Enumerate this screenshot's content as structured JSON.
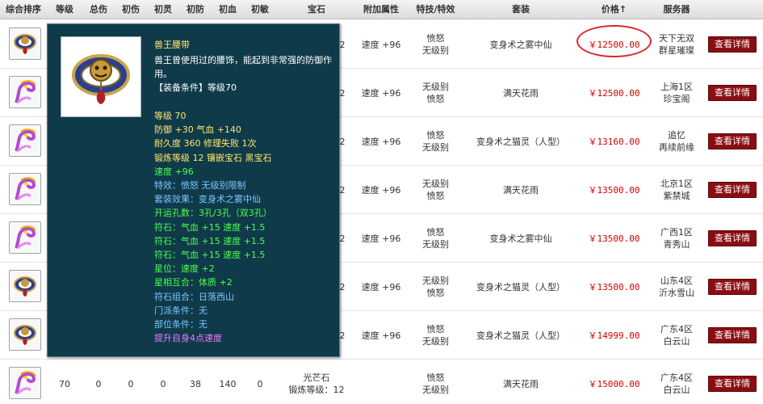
{
  "header": {
    "columns": [
      "综合排序",
      "等级",
      "总伤",
      "初伤",
      "初灵",
      "初防",
      "初血",
      "初敏",
      "宝石",
      "附加属性",
      "特技/特效",
      "套装",
      "价格",
      "服务器"
    ],
    "sort_arrow": "↑"
  },
  "rows": [
    {
      "icon": "belt-icon",
      "attr": "速度 +96",
      "skill1": "愤怒",
      "skill2": "无级别",
      "suit": "变身术之雾中仙",
      "price": "￥12500.00",
      "server1": "天下无双",
      "server2": "群星璀璨",
      "button": "查看详情",
      "gem_tail": "2"
    },
    {
      "icon": "ribbon-icon",
      "attr": "速度 +96",
      "skill1": "无级别",
      "skill2": "愤怒",
      "suit": "满天花雨",
      "price": "￥12500.00",
      "server1": "上海1区",
      "server2": "珍宝阁",
      "button": "查看详情",
      "gem_tail": "2"
    },
    {
      "icon": "ribbon-icon",
      "attr": "速度 +96",
      "skill1": "愤怒",
      "skill2": "无级别",
      "suit": "变身术之猫灵（人型）",
      "price": "￥13160.00",
      "server1": "追忆",
      "server2": "再续前缘",
      "button": "查看详情",
      "gem_tail": "2"
    },
    {
      "icon": "ribbon-icon",
      "attr": "速度 +96",
      "skill1": "无级别",
      "skill2": "愤怒",
      "suit": "满天花雨",
      "price": "￥13500.00",
      "server1": "北京1区",
      "server2": "紫禁城",
      "button": "查看详情",
      "gem_tail": "2"
    },
    {
      "icon": "ribbon-icon",
      "attr": "速度 +96",
      "skill1": "愤怒",
      "skill2": "无级别",
      "suit": "变身术之雾中仙",
      "price": "￥13500.00",
      "server1": "广西1区",
      "server2": "青秀山",
      "button": "查看详情",
      "gem_tail": "2"
    },
    {
      "icon": "belt-icon",
      "attr": "速度 +96",
      "skill1": "无级别",
      "skill2": "愤怒",
      "suit": "变身术之猫灵（人型）",
      "price": "￥13500.00",
      "server1": "山东4区",
      "server2": "沂水雪山",
      "button": "查看详情",
      "gem_tail": "2"
    },
    {
      "icon": "belt-icon",
      "attr": "速度 +96",
      "skill1": "愤怒",
      "skill2": "无级别",
      "suit": "变身术之猫灵（人型）",
      "price": "￥14999.00",
      "server1": "广东4区",
      "server2": "白云山",
      "button": "查看详情",
      "gem_tail": "2"
    },
    {
      "icon": "ribbon-icon",
      "level": "70",
      "total": "0",
      "init_dmg": "0",
      "init_ling": "0",
      "init_def": "38",
      "init_hp": "140",
      "init_agi": "0",
      "gem1": "光芒石",
      "gem2": "锻炼等级：12",
      "skill1": "愤怒",
      "skill2": "无级别",
      "suit": "满天花雨",
      "price": "￥15000.00",
      "server1": "广东4区",
      "server2": "白云山",
      "button": "查看详情"
    }
  ],
  "tooltip": {
    "name": "兽王腰带",
    "desc": "兽王曾使用过的腰饰，能起到非常强的防御作用。",
    "requirement": "【装备条件】等级70",
    "lines": [
      {
        "text": "等级 70",
        "color": "#ffe86b"
      },
      {
        "text": "防御 +30 气血 +140",
        "color": "#ffe86b"
      },
      {
        "text": "耐久度 360 修理失败 1次",
        "color": "#ffe86b"
      },
      {
        "text": "锻炼等级 12 镶嵌宝石 黑宝石",
        "color": "#ffe86b"
      },
      {
        "text": "速度 +96",
        "color": "#4dff4d"
      },
      {
        "text": "特效：愤怒 无级别限制",
        "color": "#7fc6ff"
      },
      {
        "text": "套装效果：变身术之雾中仙",
        "color": "#7fc6ff"
      },
      {
        "text": "开运孔数：3孔/3孔（双3孔）",
        "color": "#4dff4d"
      },
      {
        "text": "符石：气血 +15 速度 +1.5",
        "color": "#4dff4d"
      },
      {
        "text": "符石：气血 +15 速度 +1.5",
        "color": "#4dff4d"
      },
      {
        "text": "符石：气血 +15 速度 +1.5",
        "color": "#4dff4d"
      },
      {
        "text": "星位：速度 +2",
        "color": "#4dff4d"
      },
      {
        "text": "星相互合：体质 +2",
        "color": "#4dff4d"
      },
      {
        "text": "符石组合：日落西山",
        "color": "#7fc6ff"
      },
      {
        "text": "门派条件：无",
        "color": "#7fc6ff"
      },
      {
        "text": "部位条件：无",
        "color": "#7fc6ff"
      },
      {
        "text": "提升自身4点速度",
        "color": "#e87bff"
      }
    ]
  },
  "colors": {
    "price": "#d40000",
    "button_bg": "#8a0d12",
    "tooltip_bg": "#0f3a4a",
    "highlight_circle": "#d8282a"
  }
}
